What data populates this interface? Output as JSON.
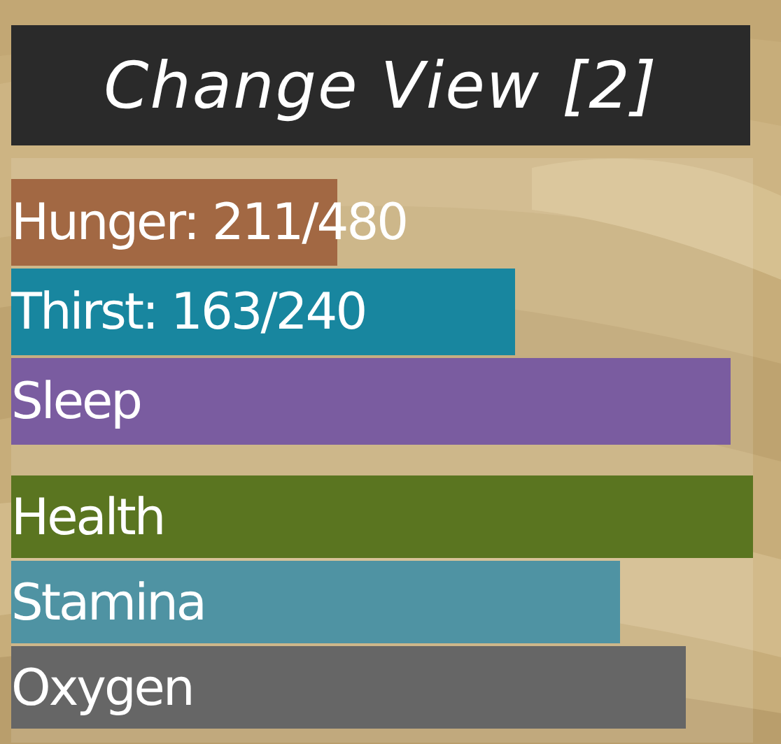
{
  "title": "Change View [2]",
  "groups": [
    {
      "bars": [
        {
          "label": "Hunger: 211/480",
          "level": 0.44,
          "color": "#a26843"
        },
        {
          "label": "Thirst: 163/240",
          "level": 0.68,
          "color": "#18869f"
        },
        {
          "label": "Sleep",
          "level": 0.97,
          "color": "#7a5ca0"
        }
      ]
    },
    {
      "bars": [
        {
          "label": "Health",
          "level": 1,
          "color": "#5a7520"
        },
        {
          "label": "Stamina",
          "level": 0.82,
          "color": "#4f93a3"
        },
        {
          "label": "Oxygen",
          "level": 0.91,
          "color": "#666666"
        }
      ]
    }
  ]
}
